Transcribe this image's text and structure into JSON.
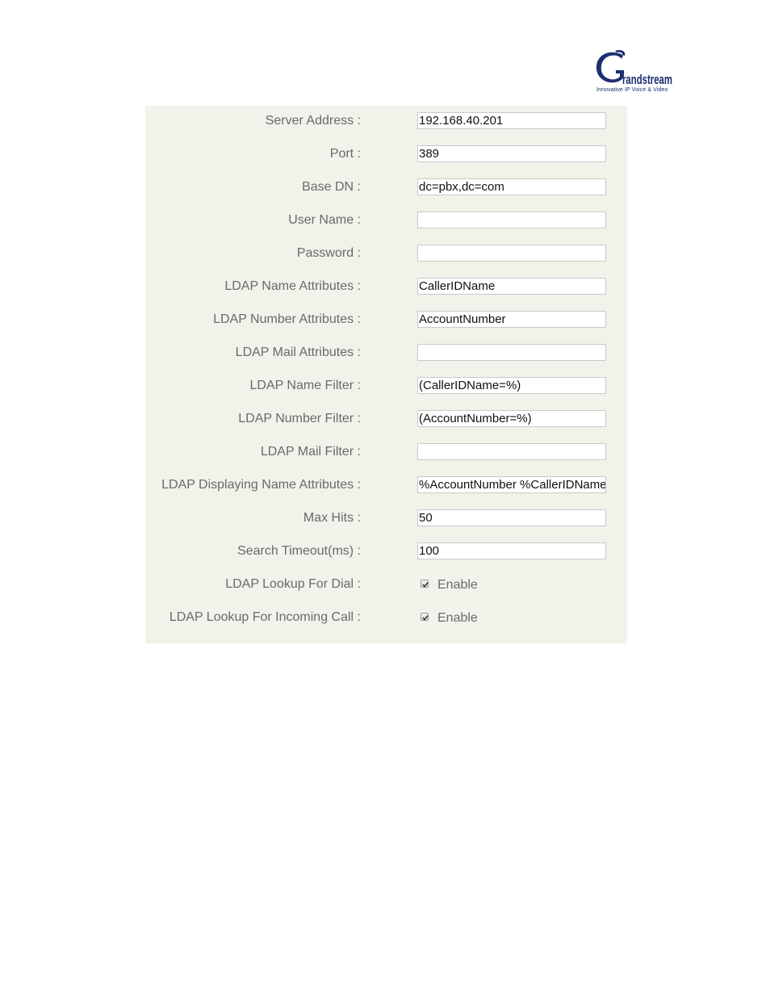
{
  "logo": {
    "brand": "Grandstream",
    "brand_rest": "randstream",
    "tagline": "Innovative IP Voice & Video",
    "icon": "grandstream-logo-icon",
    "color": "#1c2f6e"
  },
  "form": {
    "background": "#f1f2ea",
    "fields": [
      {
        "label": "Server Address :",
        "value": "192.168.40.201"
      },
      {
        "label": "Port :",
        "value": "389"
      },
      {
        "label": "Base DN :",
        "value": "dc=pbx,dc=com"
      },
      {
        "label": "User Name :",
        "value": ""
      },
      {
        "label": "Password :",
        "value": ""
      },
      {
        "label": "LDAP Name Attributes :",
        "value": "CallerIDName"
      },
      {
        "label": "LDAP Number Attributes :",
        "value": "AccountNumber"
      },
      {
        "label": "LDAP Mail Attributes :",
        "value": ""
      },
      {
        "label": "LDAP Name Filter :",
        "value": "(CallerIDName=%)"
      },
      {
        "label": "LDAP Number Filter :",
        "value": "(AccountNumber=%)"
      },
      {
        "label": "LDAP Mail Filter :",
        "value": ""
      },
      {
        "label": "LDAP Displaying Name Attributes :",
        "value": "%AccountNumber %CallerIDName"
      },
      {
        "label": "Max Hits :",
        "value": "50"
      },
      {
        "label": "Search Timeout(ms) :",
        "value": "100"
      }
    ],
    "checkboxes": [
      {
        "label": "LDAP Lookup For Dial :",
        "option": "Enable",
        "checked": true
      },
      {
        "label": "LDAP Lookup For Incoming Call :",
        "option": "Enable",
        "checked": true
      }
    ]
  }
}
